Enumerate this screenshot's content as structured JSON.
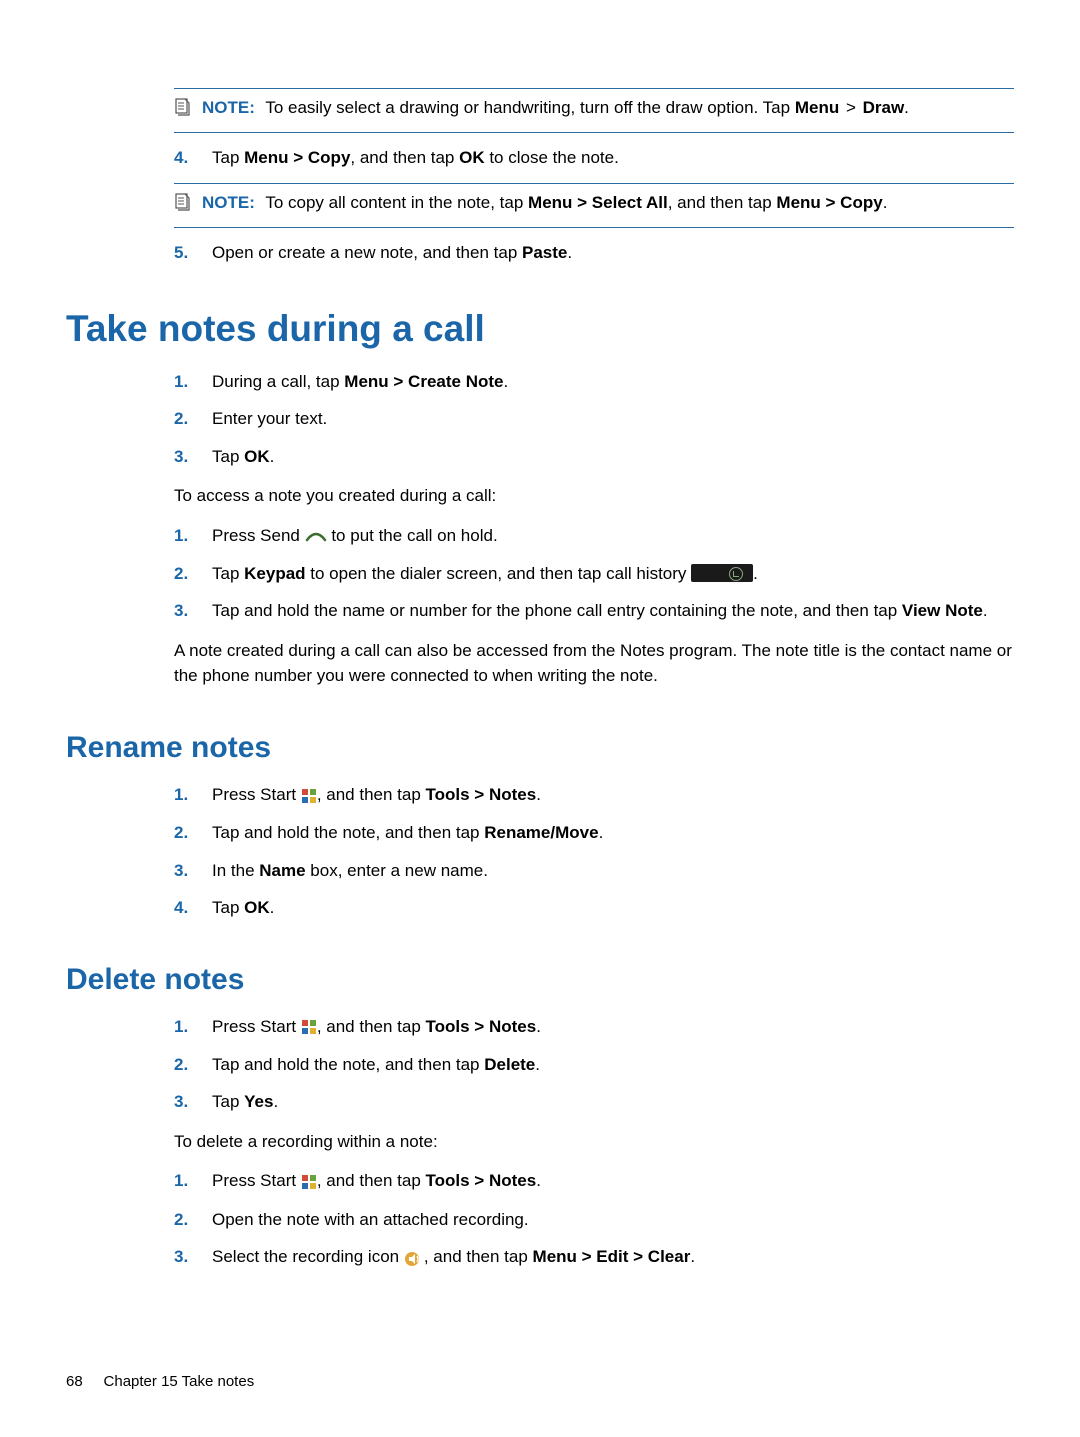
{
  "note1": {
    "label": "NOTE:",
    "pre": "To easily select a drawing or handwriting, turn off the draw option. Tap ",
    "menu": "Menu",
    "gt": " > ",
    "draw": "Draw",
    "end": "."
  },
  "step4": {
    "num": "4.",
    "pre": "Tap ",
    "bold": "Menu > Copy",
    "mid": ", and then tap ",
    "ok": "OK",
    "end": " to close the note."
  },
  "note2": {
    "label": "NOTE:",
    "pre": "To copy all content in the note, tap ",
    "b1": "Menu > Select All",
    "mid": ", and then tap ",
    "b2": "Menu > Copy",
    "end": "."
  },
  "step5": {
    "num": "5.",
    "pre": "Open or create a new note, and then tap ",
    "b": "Paste",
    "end": "."
  },
  "h_take": "Take notes during a call",
  "take": {
    "s1": {
      "num": "1.",
      "pre": "During a call, tap ",
      "b": "Menu > Create Note",
      "end": "."
    },
    "s2": {
      "num": "2.",
      "text": "Enter your text."
    },
    "s3": {
      "num": "3.",
      "pre": "Tap ",
      "b": "OK",
      "end": "."
    }
  },
  "para_access": "To access a note you created during a call:",
  "access": {
    "s1": {
      "num": "1.",
      "pre": "Press Send ",
      "post": " to put the call on hold."
    },
    "s2": {
      "num": "2.",
      "pre": "Tap ",
      "b": "Keypad",
      "mid": " to open the dialer screen, and then tap call history ",
      "end": "."
    },
    "s3": {
      "num": "3.",
      "pre": "Tap and hold the name or number for the phone call entry containing the note, and then tap ",
      "b": "View Note",
      "end": "."
    }
  },
  "para_noteinfo": "A note created during a call can also be accessed from the Notes program. The note title is the contact name or the phone number you were connected to when writing the note.",
  "h_rename": "Rename notes",
  "rename": {
    "s1": {
      "num": "1.",
      "pre": "Press Start ",
      "mid": ", and then tap ",
      "b": "Tools > Notes",
      "end": "."
    },
    "s2": {
      "num": "2.",
      "pre": "Tap and hold the note, and then tap ",
      "b": "Rename/Move",
      "end": "."
    },
    "s3": {
      "num": "3.",
      "pre": "In the ",
      "b": "Name",
      "mid": " box, enter a new name."
    },
    "s4": {
      "num": "4.",
      "pre": "Tap ",
      "b": "OK",
      "end": "."
    }
  },
  "h_delete": "Delete notes",
  "delete": {
    "s1": {
      "num": "1.",
      "pre": "Press Start ",
      "mid": ", and then tap ",
      "b": "Tools > Notes",
      "end": "."
    },
    "s2": {
      "num": "2.",
      "pre": "Tap and hold the note, and then tap ",
      "b": "Delete",
      "end": "."
    },
    "s3": {
      "num": "3.",
      "pre": "Tap ",
      "b": "Yes",
      "end": "."
    }
  },
  "para_delrec": "To delete a recording within a note:",
  "delrec": {
    "s1": {
      "num": "1.",
      "pre": "Press Start ",
      "mid": ", and then tap ",
      "b": "Tools > Notes",
      "end": "."
    },
    "s2": {
      "num": "2.",
      "text": "Open the note with an attached recording."
    },
    "s3": {
      "num": "3.",
      "pre": "Select the recording icon ",
      "mid": ", and then tap ",
      "b": "Menu > Edit > Clear",
      "end": "."
    }
  },
  "footer": {
    "page": "68",
    "chapter": "Chapter 15   Take notes"
  }
}
